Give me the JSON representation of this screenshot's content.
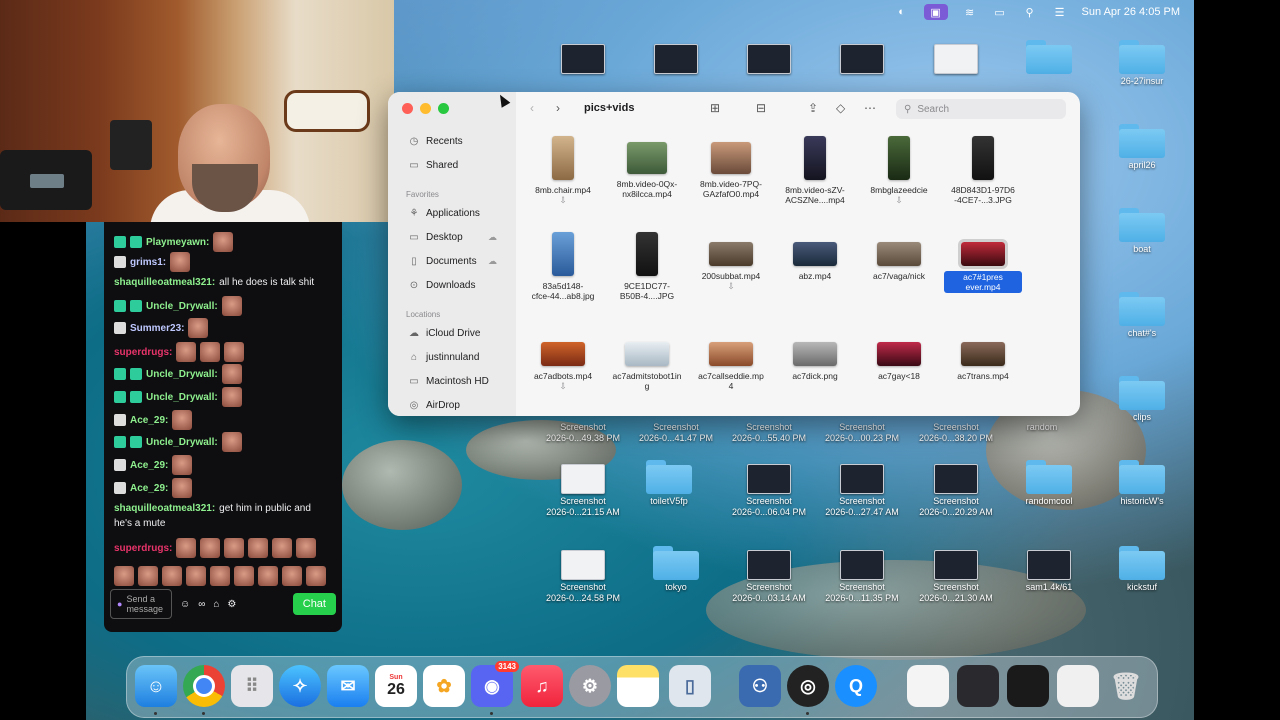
{
  "menubar": {
    "clock": "Sun Apr 26  4:05 PM"
  },
  "webcam": {
    "description": ""
  },
  "chat": {
    "lines": [
      {
        "user": "Playmeyawn:",
        "color": "#8ef08e",
        "msg": ""
      },
      {
        "user": "grims1:",
        "color": "#bfc8ff",
        "msg": ""
      },
      {
        "user": "shaquilleoatmeal321:",
        "color": "#8ef08e",
        "msg": "all he does is talk shit"
      },
      {
        "user": "Uncle_Drywall:",
        "color": "#8ef08e",
        "msg": ""
      },
      {
        "user": "Summer23:",
        "color": "#bfc8ff",
        "msg": ""
      },
      {
        "user": "superdrugs:",
        "color": "#e8346b",
        "msg": ""
      },
      {
        "user": "Uncle_Drywall:",
        "color": "#8ef08e",
        "msg": ""
      },
      {
        "user": "Uncle_Drywall:",
        "color": "#8ef08e",
        "msg": ""
      },
      {
        "user": "Ace_29:",
        "color": "#8ef08e",
        "msg": ""
      },
      {
        "user": "Uncle_Drywall:",
        "color": "#8ef08e",
        "msg": ""
      },
      {
        "user": "Ace_29:",
        "color": "#8ef08e",
        "msg": ""
      },
      {
        "user": "Ace_29:",
        "color": "#8ef08e",
        "msg": ""
      },
      {
        "user": "shaquilleoatmeal321:",
        "color": "#8ef08e",
        "msg": "get him in public and"
      },
      {
        "user": "",
        "color": "#8ef08e",
        "msg": "he's a mute"
      },
      {
        "user": "superdrugs:",
        "color": "#e8346b",
        "msg": ""
      }
    ],
    "input_placeholder": "Send a message",
    "chat_button": "Chat"
  },
  "finder": {
    "title": "pics+vids",
    "search_placeholder": "Search",
    "sidebar": {
      "recents": "Recents",
      "shared": "Shared",
      "favorites_header": "Favorites",
      "applications": "Applications",
      "desktop": "Desktop",
      "documents": "Documents",
      "downloads": "Downloads",
      "locations_header": "Locations",
      "icloud": "iCloud Drive",
      "user": "justinnuland",
      "hd": "Macintosh HD",
      "airdrop": "AirDrop"
    },
    "files": [
      {
        "l1": "8mb.chair.mp4",
        "l2": ""
      },
      {
        "l1": "8mb.video-0Qx-",
        "l2": "nx8ilcca.mp4"
      },
      {
        "l1": "8mb.video-7PQ-",
        "l2": "GAzfafO0.mp4"
      },
      {
        "l1": "8mb.video-sZV-",
        "l2": "ACSZNe....mp4"
      },
      {
        "l1": "8mbglazeedcie",
        "l2": ""
      },
      {
        "l1": "48D843D1-97D6",
        "l2": "-4CE7-...3.JPG"
      },
      {
        "l1": "83a5d148-",
        "l2": "cfce-44...ab8.jpg"
      },
      {
        "l1": "9CE1DC77-",
        "l2": "B50B-4....JPG"
      },
      {
        "l1": "200subbat.mp4",
        "l2": ""
      },
      {
        "l1": "abz.mp4",
        "l2": ""
      },
      {
        "l1": "ac7/vaga/nick",
        "l2": ""
      },
      {
        "l1": "ac7#1pres",
        "l2": "ever.mp4"
      },
      {
        "l1": "ac7adbots.mp4",
        "l2": ""
      },
      {
        "l1": "ac7admitstobot1in",
        "l2": "g"
      },
      {
        "l1": "ac7callseddie.mp",
        "l2": "4"
      },
      {
        "l1": "ac7dick.png",
        "l2": ""
      },
      {
        "l1": "ac7gay<18",
        "l2": ""
      },
      {
        "l1": "ac7trans.mp4",
        "l2": ""
      }
    ]
  },
  "desktop": {
    "top_row": [
      "",
      "",
      "",
      "",
      ""
    ],
    "top_folder": "",
    "insur": "26-27insur",
    "april": "april26",
    "boat": "boat",
    "chat": "chat#'s",
    "clips": "clips",
    "random": "random",
    "shots_row1": [
      {
        "l1": "Screenshot",
        "l2": "2026-0...49.38 PM"
      },
      {
        "l1": "Screenshot",
        "l2": "2026-0...41.47 PM"
      },
      {
        "l1": "Screenshot",
        "l2": "2026-0...55.40 PM"
      },
      {
        "l1": "Screenshot",
        "l2": "2026-0...00.23 PM"
      },
      {
        "l1": "Screenshot",
        "l2": "2026-0...38.20 PM"
      }
    ],
    "row2": [
      {
        "l1": "Screenshot",
        "l2": "2026-0...21.15 AM"
      },
      {
        "l1": "toiletV5fp",
        "l2": ""
      },
      {
        "l1": "Screenshot",
        "l2": "2026-0...06.04 PM"
      },
      {
        "l1": "Screenshot",
        "l2": "2026-0...27.47 AM"
      },
      {
        "l1": "Screenshot",
        "l2": "2026-0...20.29 AM"
      },
      {
        "l1": "randomcool",
        "l2": ""
      },
      {
        "l1": "historicW's",
        "l2": ""
      }
    ],
    "row3": [
      {
        "l1": "Screenshot",
        "l2": "2026-0...24.58 PM"
      },
      {
        "l1": "tokyo",
        "l2": ""
      },
      {
        "l1": "Screenshot",
        "l2": "2026-0...03.14 AM"
      },
      {
        "l1": "Screenshot",
        "l2": "2026-0...11.35 PM"
      },
      {
        "l1": "Screenshot",
        "l2": "2026-0...21.30 AM"
      },
      {
        "l1": "sam1.4k/61",
        "l2": ""
      },
      {
        "l1": "kickstuf",
        "l2": ""
      }
    ]
  },
  "dock": {
    "calendar_month": "Sun",
    "calendar_day": "26",
    "discord_badge": "3143"
  }
}
